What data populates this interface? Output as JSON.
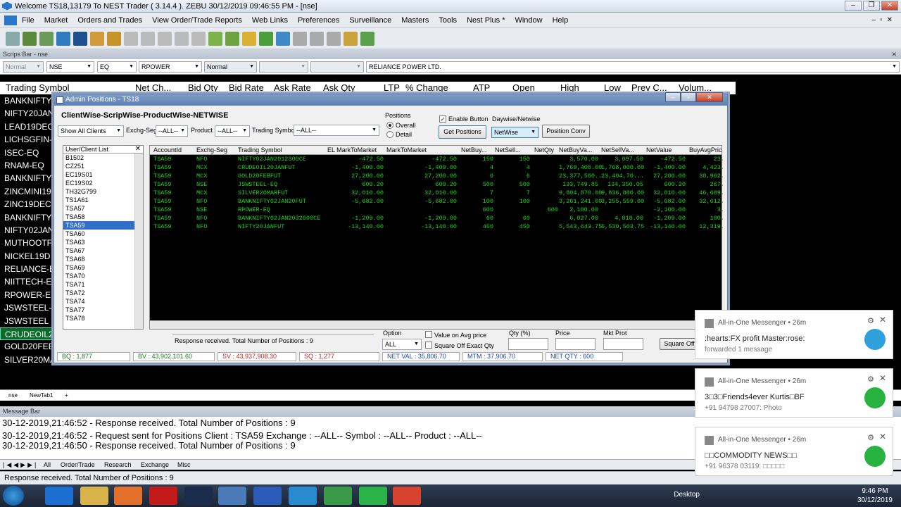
{
  "window": {
    "title": "Welcome TS18,13179 To NEST Trader ( 3.14.4 ).  ZEBU  30/12/2019  09:46:55 PM - [nse]"
  },
  "menu": [
    "File",
    "Market",
    "Orders and Trades",
    "View Order/Trade Reports",
    "Web Links",
    "Preferences",
    "Surveillance",
    "Masters",
    "Tools",
    "Nest Plus *",
    "Window",
    "Help"
  ],
  "scrips_bar": {
    "title": "Scrips Bar - nse",
    "mode": "Normal",
    "exchange": "NSE",
    "instrument": "EQ",
    "symbol": "RPOWER",
    "order_type": "Normal",
    "company": "RELIANCE POWER LTD."
  },
  "market_watch": {
    "headers": [
      "Trading Symbol",
      "Net Ch...",
      "Bid Qty",
      "Bid Rate",
      "Ask Rate",
      "Ask Qty",
      "LTP",
      "% Change",
      "ATP",
      "Open",
      "High",
      "Low",
      "Prev C...",
      "Volum..."
    ],
    "symbols": [
      "BANKNIFTY",
      "NIFTY20JAN",
      "LEAD19DEC",
      "LICHSGFIN-",
      "ISEC-EQ",
      "RNAM-EQ",
      "BANKNIFTY",
      "ZINCMINI19",
      "ZINC19DEC",
      "BANKNIFTY",
      "NIFTY02JAN",
      "MUTHOOTF",
      "NICKEL19D",
      "RELIANCE-E",
      "NIITTECH-E",
      "RPOWER-E",
      "JSWSTEEL-",
      "JSWSTEEL",
      "CRUDEOIL2",
      "GOLD20FEE",
      "SILVER20MA"
    ],
    "highlight_index": 18
  },
  "admin": {
    "caption": "Admin Positions - TS18",
    "heading": "ClientWise-ScripWise-ProductWise-NETWISE",
    "show_clients": "Show All Clients",
    "exch_seg_label": "Exchg-Seg",
    "exch_seg_value": "--ALL--",
    "product_label": "Product",
    "product_value": "--ALL--",
    "symbol_label": "Trading Symbol",
    "symbol_value": "--ALL--",
    "positions_label": "Positions",
    "overall_label": "Overall",
    "detail_label": "Detail",
    "enable_button_label": "Enable Button",
    "daywise_label": "Daywise/Netwise",
    "get_positions": "Get Positions",
    "netwise_value": "NetWise",
    "position_conv": "Position Conv",
    "user_list_header": "User/Client List",
    "users": [
      "B1502",
      "CZ251",
      "EC19S01",
      "EC19S02",
      "TH32G799",
      "TS1A61",
      "TSA57",
      "TSA58",
      "TSA59",
      "TSA60",
      "TSA63",
      "TSA67",
      "TSA68",
      "TSA69",
      "TSA70",
      "TSA71",
      "TSA72",
      "TSA74",
      "TSA77",
      "TSA78"
    ],
    "selected_user_index": 8,
    "columns": [
      "AccountId",
      "Exchg-Seg",
      "Trading Symbol",
      "EL MarkToMarket",
      "MarkToMarket",
      "NetBuy...",
      "NetSell...",
      "NetQty",
      "NetBuyVa...",
      "NetSellVa...",
      "NetValue",
      "BuyAvgPric"
    ],
    "rows": [
      [
        "TSA59",
        "NFO",
        "NIFTY02JAN2012300CE",
        "-472.50",
        "-472.50",
        "150",
        "150",
        "",
        "3,570.00",
        "3,097.50",
        "-472.50",
        "23."
      ],
      [
        "TSA59",
        "MCX",
        "CRUDEOIL20JANFUT",
        "-1,400.00",
        "-1,400.00",
        "4",
        "4",
        "",
        "1,769,400.00",
        "1,768,000.00",
        "-1,400.00",
        "4,423."
      ],
      [
        "TSA59",
        "MCX",
        "GOLD20FEBFUT",
        "27,200.00",
        "27,200.00",
        "6",
        "6",
        "",
        "23,377,500...",
        "23,404,70...",
        "27,200.00",
        "38,962."
      ],
      [
        "TSA59",
        "NSE",
        "JSWSTEEL-EQ",
        "600.20",
        "600.20",
        "500",
        "500",
        "",
        "133,749.85",
        "134,350.05",
        "600.20",
        "267."
      ],
      [
        "TSA59",
        "MCX",
        "SILVER20MARFUT",
        "32,010.00",
        "32,010.00",
        "7",
        "7",
        "",
        "9,804,870.00",
        "9,836,880.00",
        "32,010.00",
        "46,689."
      ],
      [
        "TSA59",
        "NFO",
        "BANKNIFTY02JAN20FUT",
        "-5,682.00",
        "-5,682.00",
        "100",
        "100",
        "",
        "3,261,241.00",
        "3,255,559.00",
        "-5,682.00",
        "32,612."
      ],
      [
        "TSA59",
        "NSE",
        "RPOWER-EQ",
        "",
        "",
        "600",
        "",
        "600",
        "2,100.00",
        "",
        "-2,100.00",
        "3."
      ],
      [
        "TSA59",
        "NFO",
        "BANKNIFTY02JAN2032600CE",
        "-1,209.00",
        "-1,209.00",
        "60",
        "60",
        "",
        "6,027.00",
        "4,818.00",
        "-1,209.00",
        "100."
      ],
      [
        "TSA59",
        "NFO",
        "NIFTY20JANFUT",
        "-13,140.00",
        "-13,140.00",
        "450",
        "450",
        "",
        "5,543,643.75",
        "5,530,503.75",
        "-13,140.00",
        "12,319."
      ]
    ],
    "response_text": "Response received. Total Number of Positions : 9",
    "option_label": "Option",
    "option_value": "ALL",
    "value_on_avg": "Value on Avg  price",
    "square_off_exact": "Square Off Exact Qty",
    "qty_pct_label": "Qty (%)",
    "price_label": "Price",
    "mkt_prot_label": "Mkt Prot",
    "square_off": "Square Off",
    "status": {
      "bq": "BQ : 1,877",
      "bv": "BV : 43,902,101.60",
      "sv": "SV : 43,937,908.30",
      "sq": "SQ : 1,277",
      "netval": "NET VAL : 35,806.70",
      "mtm": "MTM : 37,906.70",
      "netqty": "NET QTY : 600"
    }
  },
  "sheet_tabs": [
    "nse",
    "NewTab1",
    "+"
  ],
  "message_bar": {
    "title": "Message Bar",
    "lines": [
      "30-12-2019,21:46:52  - Response received. Total Number of Positions : 9",
      "30-12-2019,21:46:52  - Request sent for Positions  Client : TSA59 Exchange : --ALL-- Symbol : --ALL-- Product : --ALL--",
      "30-12-2019,21:46:50  - Response received. Total Number of Positions : 9"
    ],
    "tabs": [
      "All",
      "Order/Trade",
      "Research",
      "Exchange",
      "Misc"
    ]
  },
  "status_bar": "Response received. Total Number of Positions : 9",
  "notifications": [
    {
      "app": "All-in-One Messenger  •  26m",
      "line1": ":hearts:FX profit Master:rose:",
      "line2": "forwarded 1 message",
      "icon": "telegram-icon",
      "color": "#2fa0dc"
    },
    {
      "app": "All-in-One Messenger  •  26m",
      "line1": "3□3□Friends4ever Kurtis□BF",
      "line2": "+91 94798 27007: Photo",
      "icon": "whatsapp-icon",
      "color": "#28b341"
    },
    {
      "app": "All-in-One Messenger  •  26m",
      "line1": "□□COMMODITY NEWS□□",
      "line2": "+91 96378 03119: □□□□□",
      "icon": "whatsapp-icon",
      "color": "#28b341"
    }
  ],
  "taskbar": {
    "desktop": "Desktop",
    "time": "9:46 PM",
    "date": "30/12/2019"
  }
}
